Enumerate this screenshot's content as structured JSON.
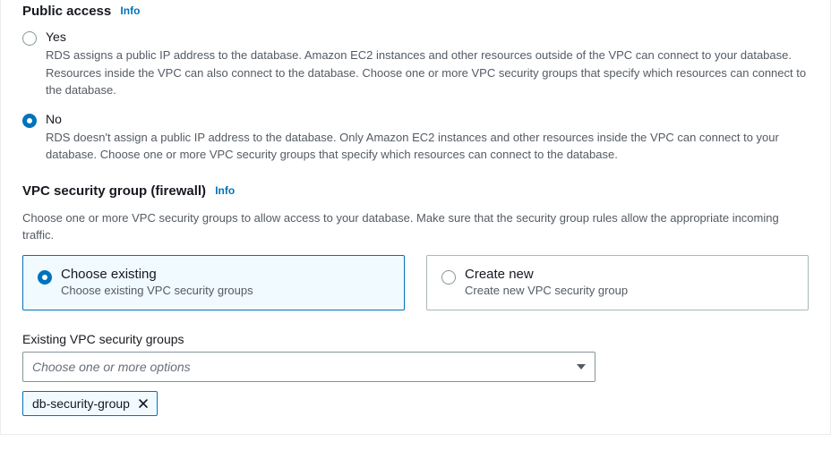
{
  "public_access": {
    "title": "Public access",
    "info_label": "Info",
    "options": {
      "yes": {
        "label": "Yes",
        "desc": "RDS assigns a public IP address to the database. Amazon EC2 instances and other resources outside of the VPC can connect to your database. Resources inside the VPC can also connect to the database. Choose one or more VPC security groups that specify which resources can connect to the database."
      },
      "no": {
        "label": "No",
        "desc": "RDS doesn't assign a public IP address to the database. Only Amazon EC2 instances and other resources inside the VPC can connect to your database. Choose one or more VPC security groups that specify which resources can connect to the database."
      }
    },
    "selected": "no"
  },
  "vpc_sg": {
    "title": "VPC security group (firewall)",
    "info_label": "Info",
    "desc": "Choose one or more VPC security groups to allow access to your database. Make sure that the security group rules allow the appropriate incoming traffic.",
    "tiles": {
      "existing": {
        "title": "Choose existing",
        "desc": "Choose existing VPC security groups"
      },
      "create": {
        "title": "Create new",
        "desc": "Create new VPC security group"
      }
    },
    "selected_tile": "existing"
  },
  "existing_groups": {
    "label": "Existing VPC security groups",
    "placeholder": "Choose one or more options",
    "selected_tokens": [
      "db-security-group"
    ]
  }
}
